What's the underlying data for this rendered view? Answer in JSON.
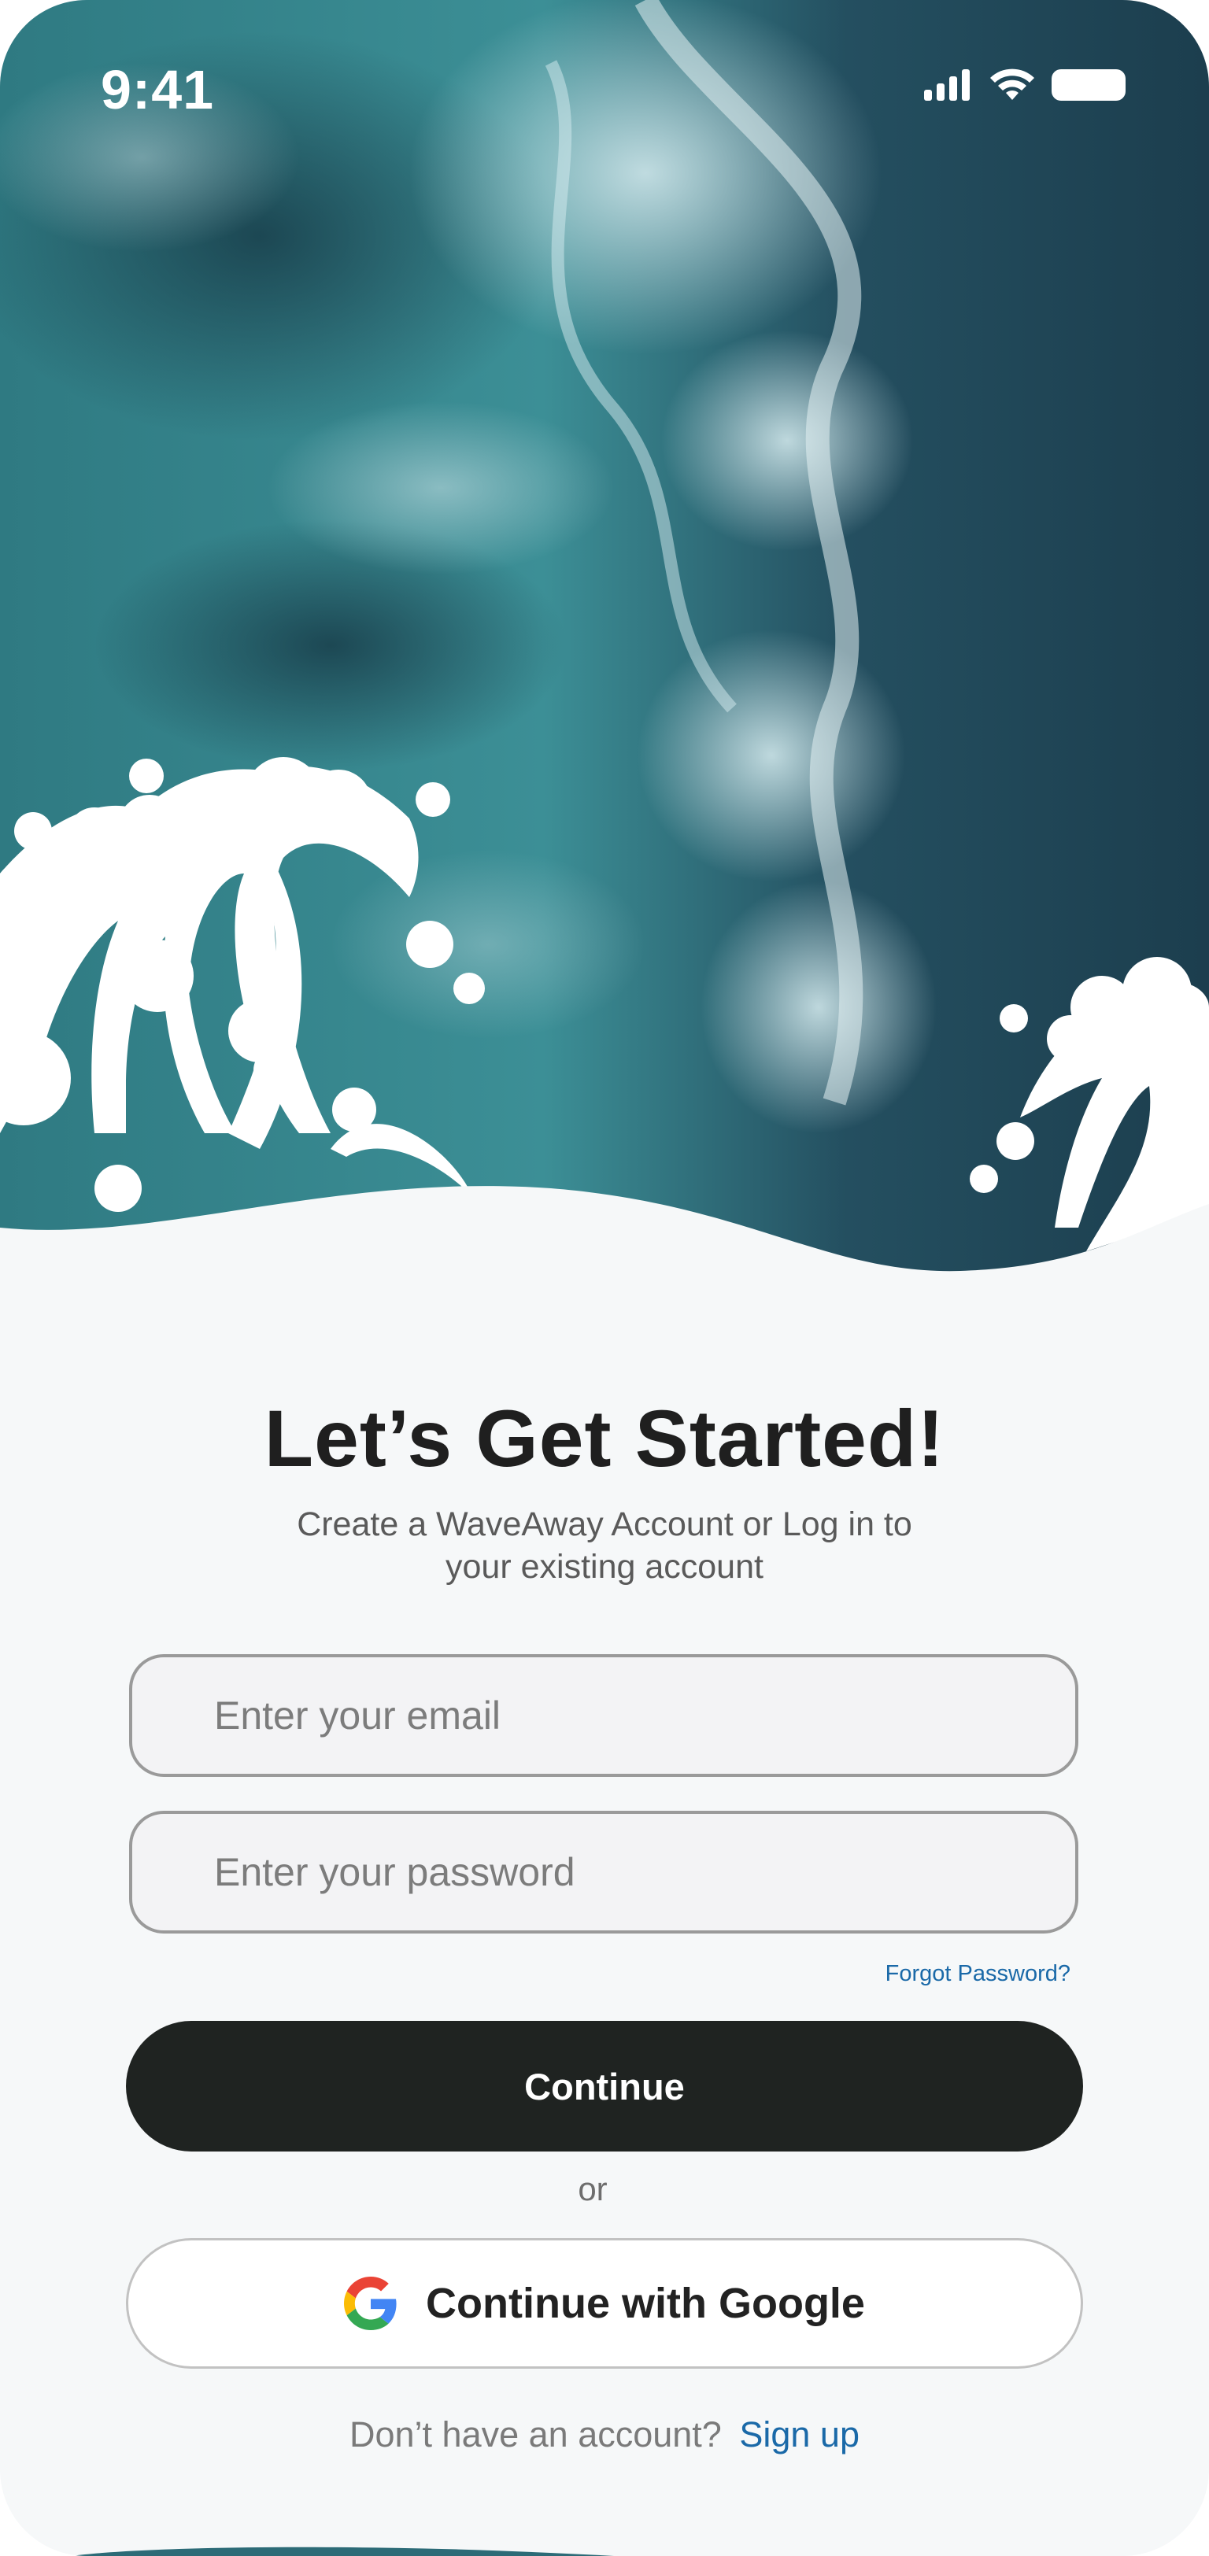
{
  "status_bar": {
    "time": "9:41"
  },
  "auth": {
    "title": "Let’s Get Started!",
    "subtitle_line1": "Create a WaveAway Account or Log in to",
    "subtitle_line2": "your existing account",
    "email_placeholder": "Enter your email",
    "password_placeholder": "Enter your password",
    "forgot_password": "Forgot Password?",
    "continue_label": "Continue",
    "or_label": "or",
    "google_label": "Continue with Google",
    "no_account_text": "Don’t have an account?",
    "signup_link": "Sign up"
  },
  "colors": {
    "primary_button": "#1f2321",
    "link": "#1a69a8",
    "sea_dark": "#1d4151",
    "sea_teal": "#3a8a91"
  },
  "icons": [
    "signal-icon",
    "wifi-icon",
    "battery-icon",
    "google-logo-icon"
  ]
}
